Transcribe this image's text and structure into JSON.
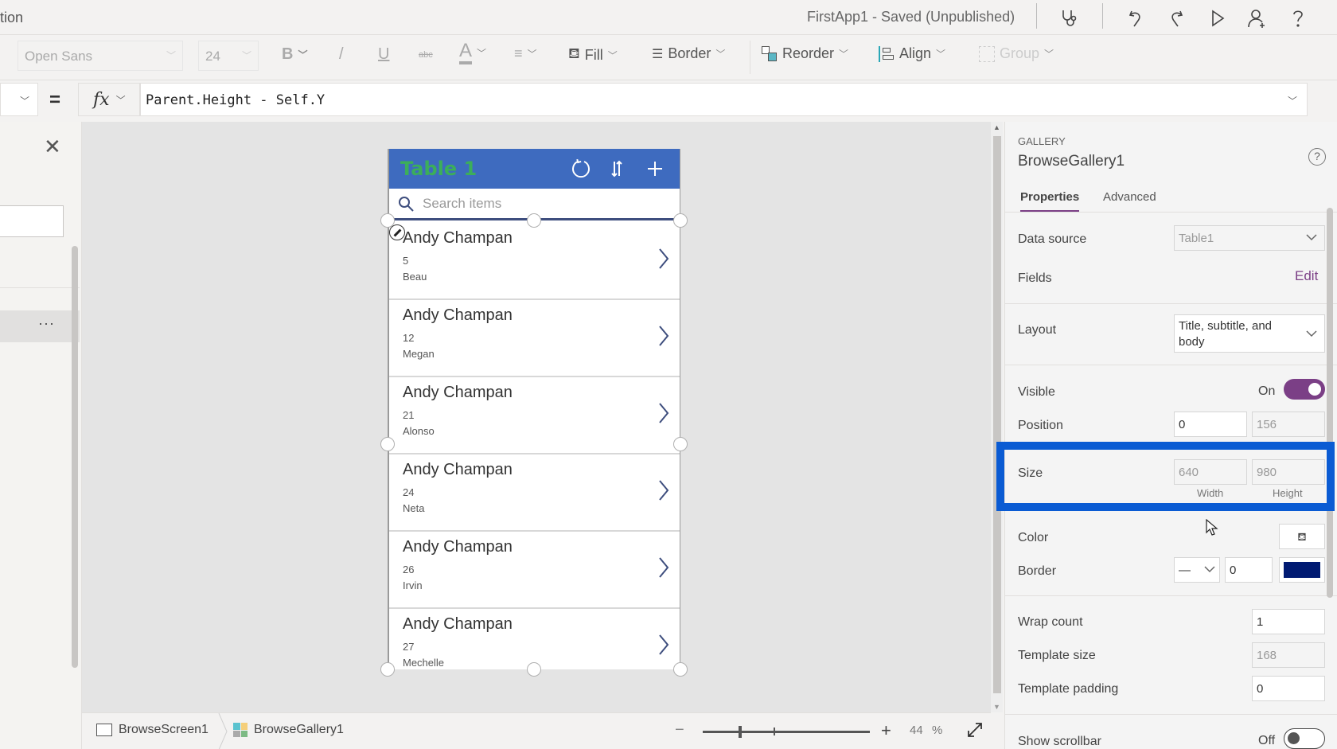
{
  "titlebar": {
    "left_cut_text": "tion",
    "app_title": "FirstApp1 - Saved (Unpublished)",
    "icons": [
      "app-checker-icon",
      "undo-icon",
      "redo-icon",
      "play-icon",
      "share-icon",
      "help-icon"
    ]
  },
  "toolbar": {
    "font_family": "Open Sans",
    "font_size": "24",
    "bold": "B",
    "italic": "/",
    "underline": "U",
    "strikethrough": "abc",
    "font_color": "A",
    "fill": "Fill",
    "border": "Border",
    "reorder": "Reorder",
    "align": "Align",
    "group": "Group"
  },
  "formula": {
    "equals": "=",
    "fx": "fx",
    "value": "Parent.Height - Self.Y"
  },
  "left_panel": {
    "close": "✕",
    "more": "···"
  },
  "app_preview": {
    "title": "Table 1",
    "title_color": "#3cae5a",
    "header_color": "#3e6bbf",
    "search_placeholder": "Search items",
    "items": [
      {
        "title": "Andy Champan",
        "subtitle": "5",
        "body": "Beau"
      },
      {
        "title": "Andy Champan",
        "subtitle": "12",
        "body": "Megan"
      },
      {
        "title": "Andy Champan",
        "subtitle": "21",
        "body": "Alonso"
      },
      {
        "title": "Andy Champan",
        "subtitle": "24",
        "body": "Neta"
      },
      {
        "title": "Andy Champan",
        "subtitle": "26",
        "body": "Irvin"
      },
      {
        "title": "Andy Champan",
        "subtitle": "27",
        "body": "Mechelle"
      }
    ]
  },
  "bottombar": {
    "crumb_screen": "BrowseScreen1",
    "crumb_gallery": "BrowseGallery1",
    "zoom_minus": "−",
    "zoom_plus": "+",
    "zoom_value": "44",
    "zoom_unit": "%"
  },
  "right_panel": {
    "control_type": "GALLERY",
    "control_name": "BrowseGallery1",
    "help": "?",
    "tabs": {
      "properties": "Properties",
      "advanced": "Advanced"
    },
    "data_source": {
      "label": "Data source",
      "value": "Table1"
    },
    "fields": {
      "label": "Fields",
      "action": "Edit"
    },
    "layout": {
      "label": "Layout",
      "value": "Title, subtitle, and body"
    },
    "visible": {
      "label": "Visible",
      "state": "On"
    },
    "position": {
      "label": "Position",
      "x": "0",
      "y": "156"
    },
    "size": {
      "label": "Size",
      "width": "640",
      "height": "980",
      "width_label": "Width",
      "height_label": "Height"
    },
    "color": {
      "label": "Color"
    },
    "border": {
      "label": "Border",
      "style": "—",
      "thickness": "0",
      "color": "#001a72"
    },
    "wrap_count": {
      "label": "Wrap count",
      "value": "1"
    },
    "template_size": {
      "label": "Template size",
      "value": "168"
    },
    "template_padding": {
      "label": "Template padding",
      "value": "0"
    },
    "show_scrollbar": {
      "label": "Show scrollbar",
      "state": "Off"
    },
    "accent_color": "#7b3f86",
    "highlight_color": "#0a5bd3"
  }
}
